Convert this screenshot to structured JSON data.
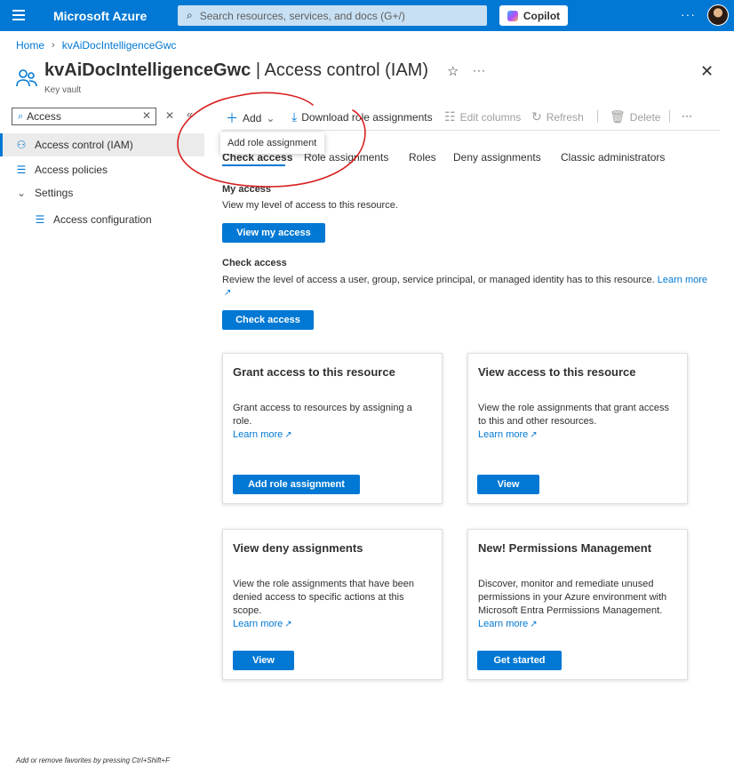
{
  "topbar": {
    "brand": "Microsoft Azure",
    "search_placeholder": "Search resources, services, and docs (G+/)",
    "copilot_label": "Copilot",
    "more_label": "···"
  },
  "breadcrumb": {
    "home": "Home",
    "resource": "kvAiDocIntelligenceGwc"
  },
  "header": {
    "resource_name": "kvAiDocIntelligenceGwc",
    "page_name": " | Access control (IAM)",
    "resource_type": "Key vault",
    "favorite_glyph": "☆",
    "more_label": "···",
    "close_glyph": "✕"
  },
  "sidebar": {
    "search_value": "Access",
    "items": [
      {
        "label": "Access control (IAM)",
        "icon": "people-icon",
        "active": true
      },
      {
        "label": "Access policies",
        "icon": "list-check-icon"
      },
      {
        "label": "Settings",
        "icon": "chevron-down-icon"
      },
      {
        "label": "Access configuration",
        "icon": "list-check-icon"
      }
    ]
  },
  "toolbar": {
    "add_label": "Add",
    "download_label": "Download role assignments",
    "edit_columns_label": "Edit columns",
    "refresh_label": "Refresh",
    "delete_label": "Delete",
    "more_label": "···",
    "tooltip": "Add role assignment"
  },
  "tabs": [
    {
      "label": "Check access",
      "active": true
    },
    {
      "label": "Role assignments"
    },
    {
      "label": "Roles"
    },
    {
      "label": "Deny assignments"
    },
    {
      "label": "Classic administrators"
    }
  ],
  "my_access": {
    "heading": "My access",
    "description": "View my level of access to this resource.",
    "button": "View my access"
  },
  "check_access": {
    "heading": "Check access",
    "description": "Review the level of access a user, group, service principal, or managed identity has to this resource.",
    "learn_more": "Learn more",
    "button": "Check access"
  },
  "cards": [
    {
      "title": "Grant access to this resource",
      "body": "Grant access to resources by assigning a role.",
      "link": "Learn more",
      "button": "Add role assignment"
    },
    {
      "title": "View access to this resource",
      "body": "View the role assignments that grant access to this and other resources.",
      "link": "Learn more",
      "button": "View"
    },
    {
      "title": "View deny assignments",
      "body": "View the role assignments that have been denied access to specific actions at this scope.",
      "link": "Learn more",
      "button": "View"
    },
    {
      "title": "New! Permissions Management",
      "body": "Discover, monitor and remediate unused permissions in your Azure environment with Microsoft Entra Permissions Management.",
      "link": "Learn more",
      "button": "Get started"
    }
  ],
  "footer": {
    "hint": "Add or remove favorites by pressing Ctrl+Shift+F"
  },
  "colors": {
    "accent": "#0078d4",
    "annotation": "#d92020"
  }
}
